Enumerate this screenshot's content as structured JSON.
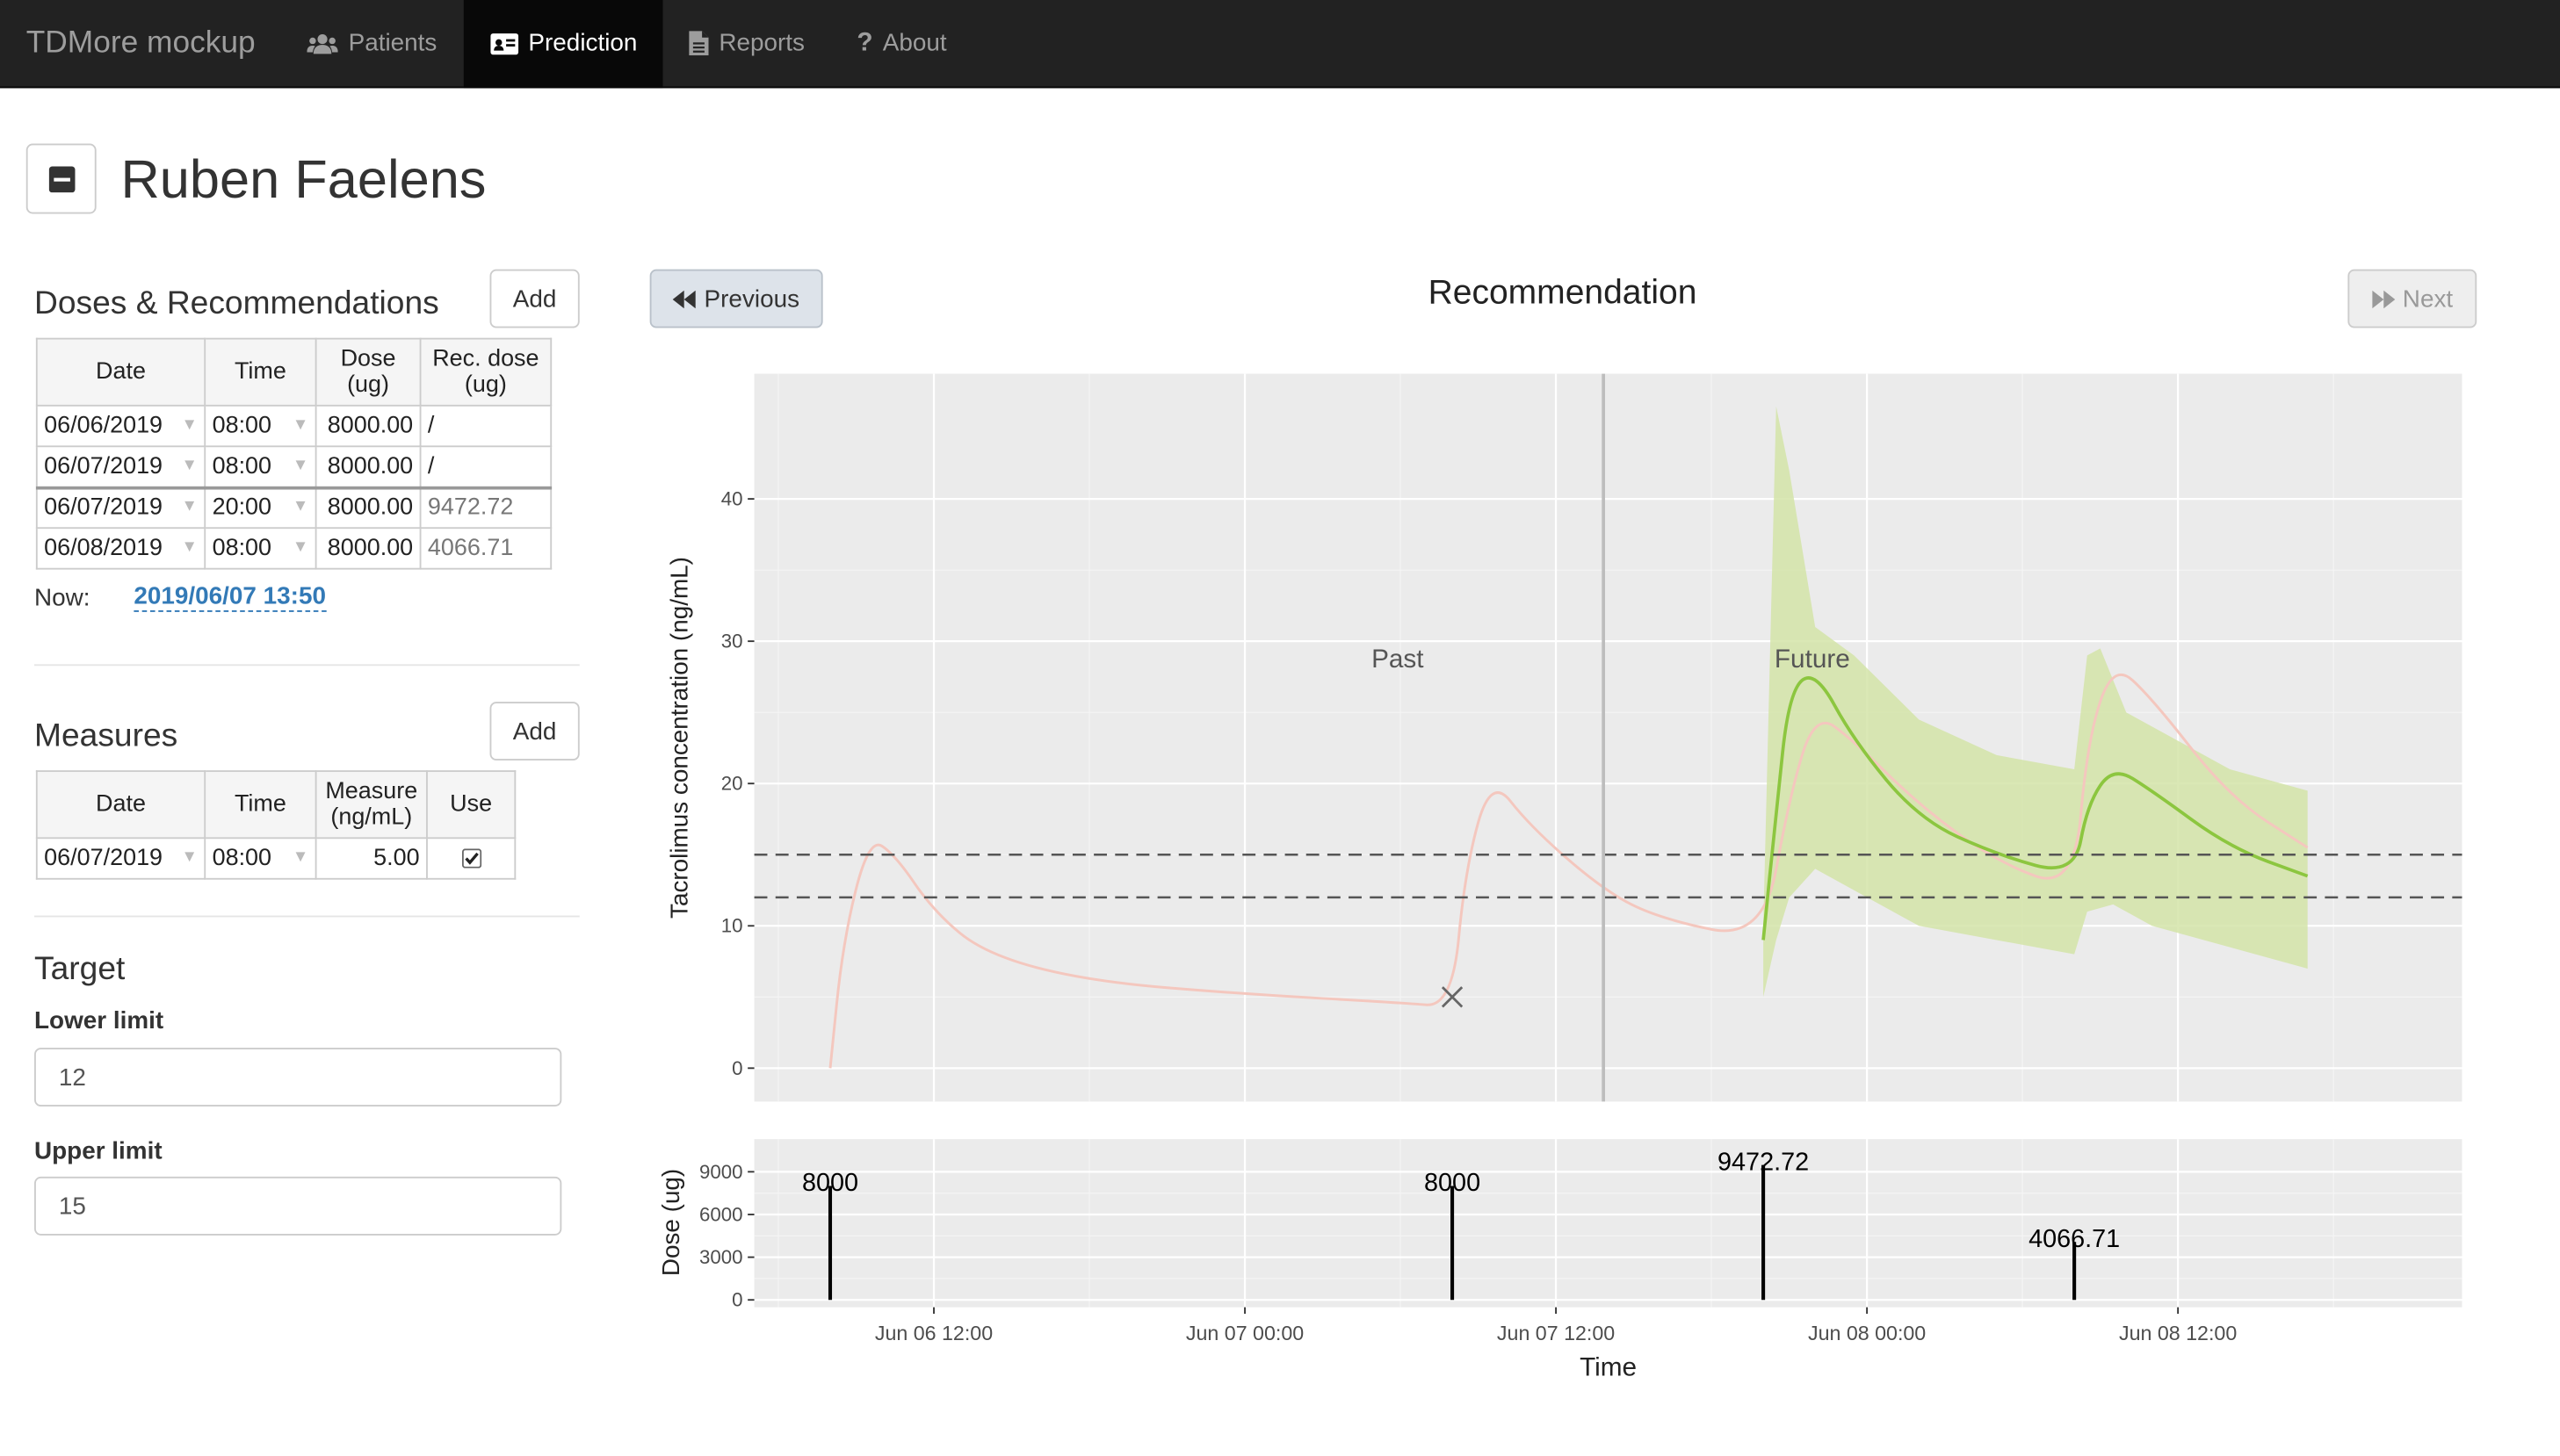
{
  "navbar": {
    "brand": "TDMore mockup",
    "items": [
      {
        "label": "Patients",
        "icon": "users-icon",
        "active": false
      },
      {
        "label": "Prediction",
        "icon": "id-card-icon",
        "active": true
      },
      {
        "label": "Reports",
        "icon": "file-icon",
        "active": false
      },
      {
        "label": "About",
        "icon": "question-icon",
        "active": false
      }
    ]
  },
  "patient": {
    "name": "Ruben Faelens"
  },
  "doses": {
    "title": "Doses & Recommendations",
    "add_label": "Add",
    "headers": {
      "date": "Date",
      "time": "Time",
      "dose_1": "Dose",
      "dose_2": "(ug)",
      "rec_1": "Rec. dose",
      "rec_2": "(ug)"
    },
    "rows": [
      {
        "date": "06/06/2019",
        "time": "08:00",
        "dose": "8000.00",
        "rec": "/"
      },
      {
        "date": "06/07/2019",
        "time": "08:00",
        "dose": "8000.00",
        "rec": "/"
      },
      {
        "date": "06/07/2019",
        "time": "20:00",
        "dose": "8000.00",
        "rec": "9472.72"
      },
      {
        "date": "06/08/2019",
        "time": "08:00",
        "dose": "8000.00",
        "rec": "4066.71"
      }
    ],
    "now_label": "Now:",
    "now_value": "2019/06/07 13:50"
  },
  "measures": {
    "title": "Measures",
    "add_label": "Add",
    "headers": {
      "date": "Date",
      "time": "Time",
      "measure_1": "Measure",
      "measure_2": "(ng/mL)",
      "use": "Use"
    },
    "rows": [
      {
        "date": "06/07/2019",
        "time": "08:00",
        "measure": "5.00",
        "use": true
      }
    ]
  },
  "target": {
    "title": "Target",
    "lower_label": "Lower limit",
    "lower_value": "12",
    "upper_label": "Upper limit",
    "upper_value": "15"
  },
  "recommendation": {
    "title": "Recommendation",
    "previous_label": "Previous",
    "next_label": "Next"
  },
  "colors": {
    "past_curve": "#f4c7be",
    "future_curve": "#8cc63f",
    "ci_band": "#d4e4a8",
    "panel_bg": "#ebebeb"
  },
  "chart_data": [
    {
      "type": "line",
      "title": "",
      "xlabel": "",
      "ylabel": "Tacrolimus concentration (ng/mL)",
      "ylim": [
        0,
        45
      ],
      "yticks": [
        0,
        10,
        20,
        30,
        40
      ],
      "grid": true,
      "annotations": {
        "past": "Past",
        "future": "Future",
        "now": "2019-06-07 13:50"
      },
      "target_lines": [
        12,
        15
      ],
      "observations": [
        {
          "x": "2019-06-07 08:00",
          "y": 5
        }
      ],
      "series": [
        {
          "role": "past",
          "x": [
            "2019-06-06 08:00",
            "2019-06-06 08:30",
            "2019-06-06 09:30",
            "2019-06-06 10:30",
            "2019-06-06 12:00",
            "2019-06-06 14:00",
            "2019-06-06 18:00",
            "2019-06-07 00:00",
            "2019-06-07 06:00",
            "2019-06-07 08:00",
            "2019-06-07 08:30",
            "2019-06-07 09:30",
            "2019-06-07 11:00",
            "2019-06-07 13:50",
            "2019-06-07 16:00",
            "2019-06-07 20:00",
            "2019-06-07 21:00",
            "2019-06-07 22:00",
            "2019-06-07 23:30",
            "2019-06-08 02:00",
            "2019-06-08 05:00",
            "2019-06-08 08:00",
            "2019-06-08 08:30",
            "2019-06-08 09:30",
            "2019-06-08 11:00",
            "2019-06-08 14:00",
            "2019-06-08 17:00"
          ],
          "y": [
            0,
            9,
            16.2,
            15,
            11,
            8,
            6.1,
            5.2,
            4.6,
            4.3,
            14,
            20.5,
            17,
            12.5,
            10.5,
            9,
            19,
            25,
            23,
            18.5,
            14.5,
            12.5,
            23,
            28.5,
            26,
            19,
            15.5
          ]
        },
        {
          "role": "future",
          "x": [
            "2019-06-07 20:00",
            "2019-06-07 20:30",
            "2019-06-07 21:00",
            "2019-06-07 22:00",
            "2019-06-07 23:30",
            "2019-06-08 02:00",
            "2019-06-08 05:00",
            "2019-06-08 08:00",
            "2019-06-08 08:30",
            "2019-06-08 09:30",
            "2019-06-08 11:00",
            "2019-06-08 14:00",
            "2019-06-08 17:00"
          ],
          "y": [
            9,
            18,
            26.5,
            28,
            23,
            17.5,
            15,
            13.5,
            18.5,
            21.2,
            19.5,
            15.5,
            13.5
          ]
        },
        {
          "role": "ci_upper",
          "x": [
            "2019-06-07 20:00",
            "2019-06-07 20:30",
            "2019-06-07 21:00",
            "2019-06-07 22:00",
            "2019-06-07 23:30",
            "2019-06-08 02:00",
            "2019-06-08 05:00",
            "2019-06-08 08:00",
            "2019-06-08 08:30",
            "2019-06-08 09:00",
            "2019-06-08 10:00",
            "2019-06-08 14:00",
            "2019-06-08 17:00"
          ],
          "y": [
            10,
            46.5,
            42,
            31,
            29,
            24.5,
            22,
            21,
            29,
            29.5,
            25,
            21,
            19.5
          ]
        },
        {
          "role": "ci_lower",
          "x": [
            "2019-06-07 20:00",
            "2019-06-07 20:30",
            "2019-06-07 21:00",
            "2019-06-07 22:00",
            "2019-06-07 23:30",
            "2019-06-08 02:00",
            "2019-06-08 05:00",
            "2019-06-08 08:00",
            "2019-06-08 08:30",
            "2019-06-08 09:30",
            "2019-06-08 11:00",
            "2019-06-08 14:00",
            "2019-06-08 17:00"
          ],
          "y": [
            5,
            9,
            12,
            14,
            12.5,
            10,
            9,
            8,
            11,
            11.5,
            10,
            8.5,
            7
          ]
        }
      ]
    },
    {
      "type": "bar",
      "xlabel": "Time",
      "ylabel": "Dose (ug)",
      "ylim": [
        0,
        10000
      ],
      "yticks": [
        0,
        3000,
        6000,
        9000
      ],
      "xticks": [
        "Jun 06 12:00",
        "Jun 07 00:00",
        "Jun 07 12:00",
        "Jun 08 00:00",
        "Jun 08 12:00"
      ],
      "x": [
        "2019-06-06 08:00",
        "2019-06-07 08:00",
        "2019-06-07 20:00",
        "2019-06-08 08:00"
      ],
      "values": [
        8000,
        8000,
        9472.72,
        4066.71
      ],
      "labels": [
        "8000",
        "8000",
        "9472.72",
        "4066.71"
      ]
    }
  ]
}
